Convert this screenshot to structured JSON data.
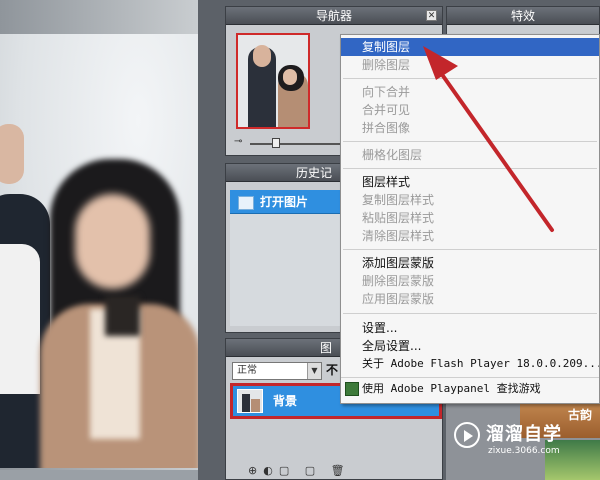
{
  "panels": {
    "navigator": {
      "title": "导航器",
      "close_glyph": "✕"
    },
    "effects": {
      "title": "特效"
    },
    "history": {
      "title": "历史记",
      "item": "打开图片"
    },
    "layers": {
      "title": "图",
      "blend_mode": "正常",
      "opacity_label": "不",
      "layer_name": "背景",
      "tools": "⊕◐▢ ▢ 🗑"
    }
  },
  "context_menu": {
    "groups": [
      [
        "复制图层",
        "删除图层"
      ],
      [
        "向下合并",
        "合并可见",
        "拼合图像"
      ],
      [
        "栅格化图层"
      ],
      [
        "图层样式",
        "复制图层样式",
        "粘贴图层样式",
        "清除图层样式"
      ],
      [
        "添加图层蒙版",
        "删除图层蒙版",
        "应用图层蒙版"
      ],
      [
        "设置...",
        "全局设置...",
        "关于 Adobe Flash Player 18.0.0.209..."
      ],
      [
        "使用 Adobe Playpanel 查找游戏"
      ]
    ],
    "highlighted": "复制图层",
    "disabled": [
      "删除图层",
      "向下合并",
      "合并可见",
      "拼合图像",
      "栅格化图层",
      "复制图层样式",
      "粘贴图层样式",
      "清除图层样式",
      "删除图层蒙版",
      "应用图层蒙版"
    ]
  },
  "watermark": {
    "title": "溜溜自学",
    "url": "zixue.3066.com"
  },
  "thumb_label": "古韵",
  "colors": {
    "highlight": "#3166c4",
    "selection": "#2f8fe0",
    "annotation": "#c3262b"
  }
}
